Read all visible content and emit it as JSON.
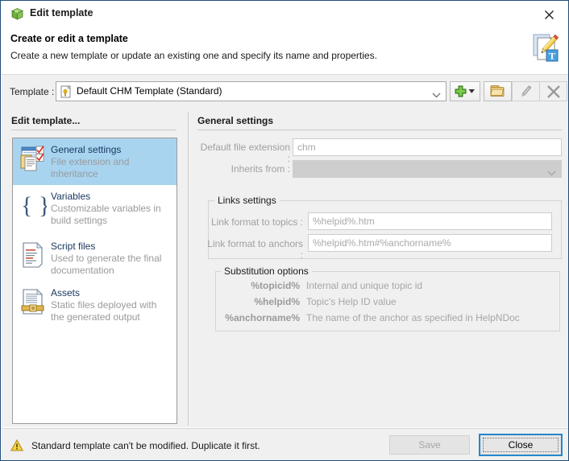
{
  "window": {
    "title": "Edit template",
    "title_icon": "helpndoc-cube-icon",
    "close_label": "✕",
    "border_color": "#1f4e79"
  },
  "header": {
    "title": "Create or edit a template",
    "subtitle": "Create a new template or update an existing one and specify its name and properties.",
    "icon": "document-pencil-text-icon"
  },
  "template_row": {
    "label": "Template :",
    "combo_icon": "chm-file-icon",
    "combo_value": "Default CHM Template (Standard)",
    "combo_arrow": "chevron-down-icon",
    "buttons": [
      {
        "name": "add-template-button",
        "icon": "green-plus-icon",
        "has_dropdown": true,
        "enabled": true
      },
      {
        "name": "open-template-folder-button",
        "icon": "folder-icon",
        "has_dropdown": false,
        "enabled": true
      },
      {
        "name": "rename-template-button",
        "icon": "pencil-icon",
        "has_dropdown": false,
        "enabled": false
      },
      {
        "name": "delete-template-button",
        "icon": "x-cross-icon",
        "has_dropdown": false,
        "enabled": false
      }
    ]
  },
  "left_pane": {
    "heading": "Edit template...",
    "items": [
      {
        "title": "General settings",
        "subtitle": "File extension and inheritance",
        "icon": "general-settings-icon",
        "selected": true
      },
      {
        "title": "Variables",
        "subtitle": "Customizable variables in build settings",
        "icon": "braces-icon",
        "selected": false
      },
      {
        "title": "Script files",
        "subtitle": "Used to generate the final documentation",
        "icon": "script-file-icon",
        "selected": false
      },
      {
        "title": "Assets",
        "subtitle": "Static files deployed with the generated output",
        "icon": "assets-document-icon",
        "selected": false
      }
    ],
    "selection_color": "#a8d4f0"
  },
  "right_pane": {
    "heading": "General settings",
    "fields": [
      {
        "label": "Default file extension :",
        "value": "chm",
        "type": "textbox",
        "enabled": false
      },
      {
        "label": "Inherits from :",
        "value": "",
        "type": "combobox",
        "enabled": false
      }
    ],
    "links_group": {
      "caption": "Links settings",
      "fields": [
        {
          "label": "Link format to topics :",
          "value": "%helpid%.htm",
          "enabled": false
        },
        {
          "label": "Link format to anchors :",
          "value": "%helpid%.htm#%anchorname%",
          "enabled": false
        }
      ]
    },
    "substitution_group": {
      "caption": "Substitution options",
      "rows": [
        {
          "key": "%topicid%",
          "desc": "Internal and unique topic id"
        },
        {
          "key": "%helpid%",
          "desc": "Topic's Help ID value"
        },
        {
          "key": "%anchorname%",
          "desc": "The name of the anchor as specified in HelpNDoc"
        }
      ]
    }
  },
  "footer": {
    "warning_icon": "warning-triangle-icon",
    "warning_text": "Standard template can't be modified. Duplicate it first.",
    "save_label": "Save",
    "save_enabled": false,
    "close_label": "Close",
    "close_focused": true
  }
}
